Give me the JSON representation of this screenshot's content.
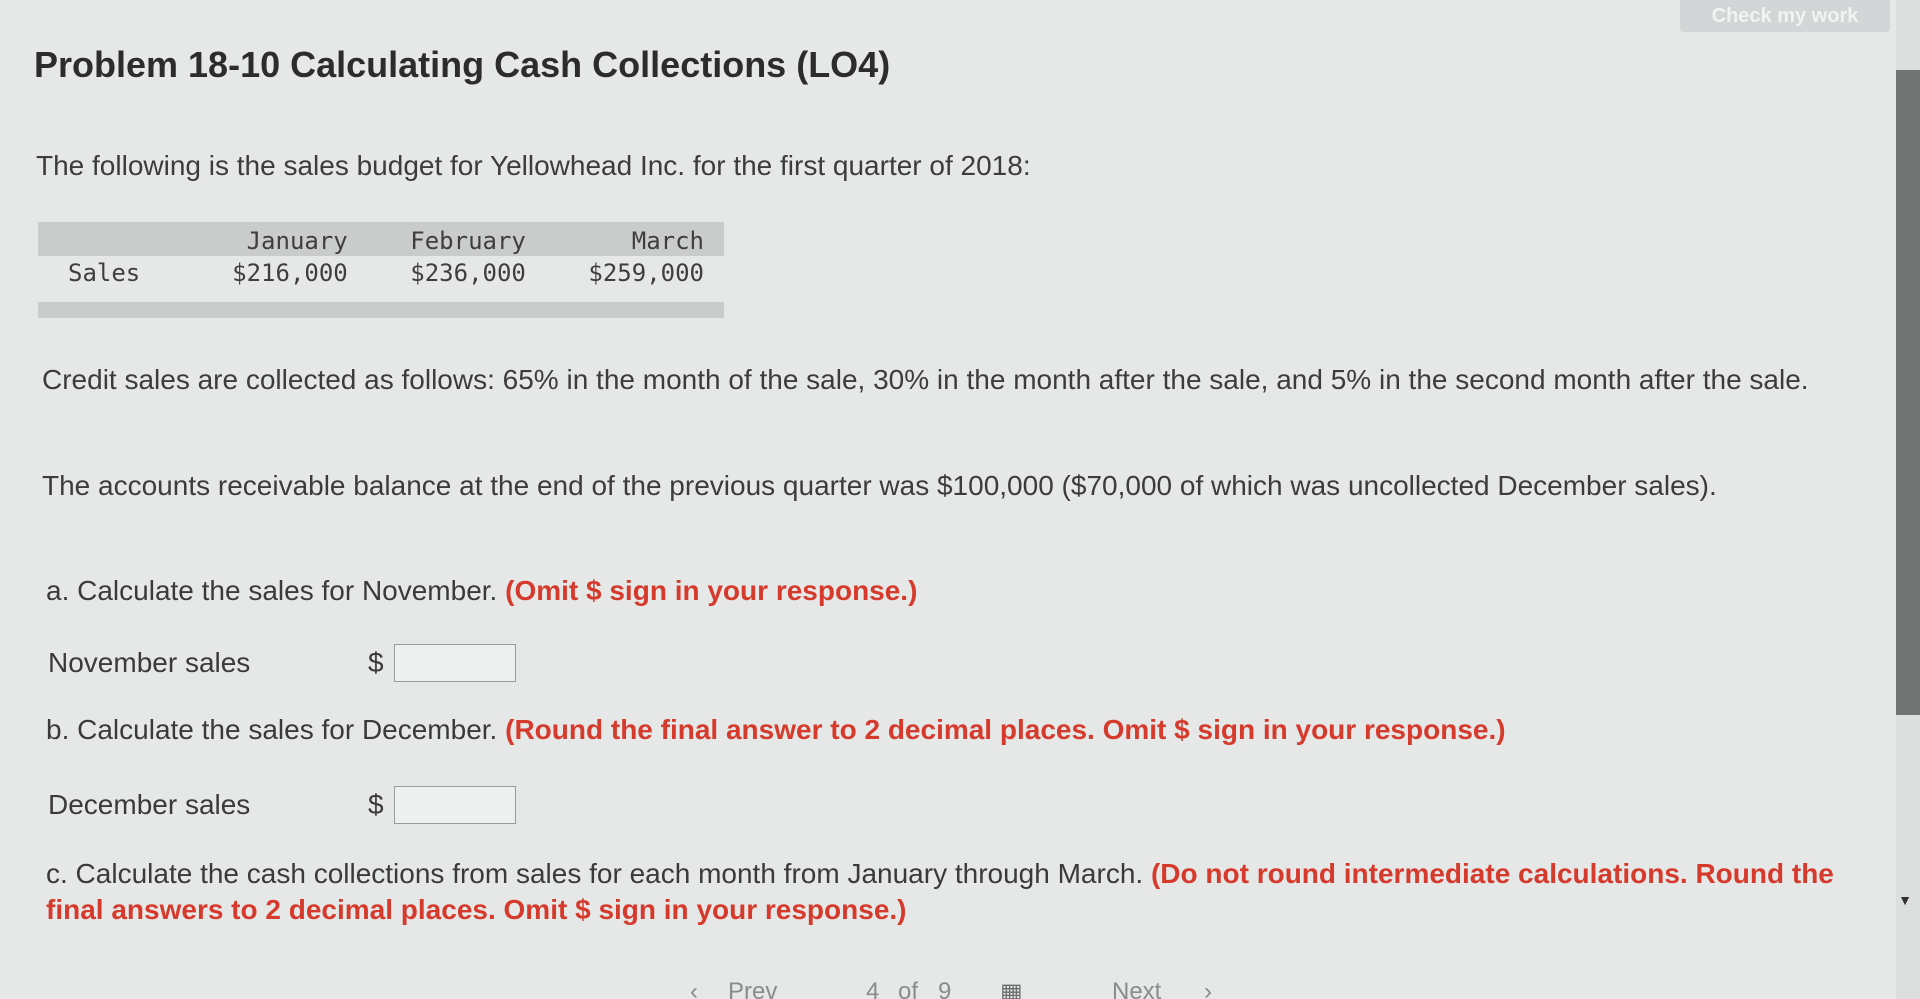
{
  "header": {
    "check_button": "Check my work",
    "title": "Problem 18-10 Calculating Cash Collections (LO4)"
  },
  "intro": "The following is the sales budget for Yellowhead Inc. for the first quarter of 2018:",
  "sales_table": {
    "columns": [
      "January",
      "February",
      "March"
    ],
    "row_label": "Sales",
    "values": [
      "$216,000",
      "$236,000",
      "$259,000"
    ]
  },
  "paragraphs": {
    "collection_policy": "Credit sales are collected as follows: 65% in the month of the sale, 30% in the month after the sale, and 5% in the second month after the sale.",
    "ar_balance": "The accounts receivable balance at the end of the previous quarter was $100,000 ($70,000 of which was uncollected December sales)."
  },
  "questions": {
    "a": {
      "text": "a. Calculate the sales for November.",
      "hint": "(Omit $ sign in your response.)"
    },
    "b": {
      "text": "b. Calculate the sales for December.",
      "hint": "(Round the final answer to 2 decimal places. Omit $ sign in your response.)"
    },
    "c": {
      "text": "c. Calculate the cash collections from sales for each month from January through March.",
      "hint": "(Do not round intermediate calculations. Round the final answers to 2 decimal places. Omit $ sign in your response.)"
    }
  },
  "answers": {
    "november": {
      "label": "November sales",
      "currency": "$",
      "value": ""
    },
    "december": {
      "label": "December sales",
      "currency": "$",
      "value": ""
    }
  },
  "nav": {
    "prev": "Prev",
    "page_current": "4",
    "page_of": "of",
    "page_total": "9",
    "next": "Next"
  }
}
